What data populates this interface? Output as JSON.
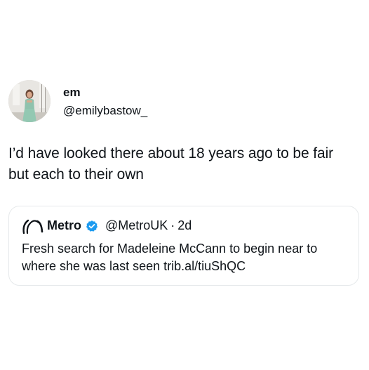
{
  "tweet": {
    "author": {
      "display_name": "em",
      "handle": "@emilybastow_",
      "avatar_icon": "profile-photo"
    },
    "text_lines": [
      "I’d have looked there about 18 years ago to be fair",
      "but each to their own"
    ]
  },
  "quote": {
    "author": {
      "display_name": "Metro",
      "handle": "@MetroUK",
      "separator": "·",
      "time_ago": "2d",
      "logo_icon": "metro-logo",
      "verified_icon": "verified-badge",
      "verified_color": "#1d9bf0"
    },
    "text_lines": [
      "Fresh search for Madeleine McCann to begin near to",
      "where she was last seen trib.al/tiuShQC"
    ]
  }
}
